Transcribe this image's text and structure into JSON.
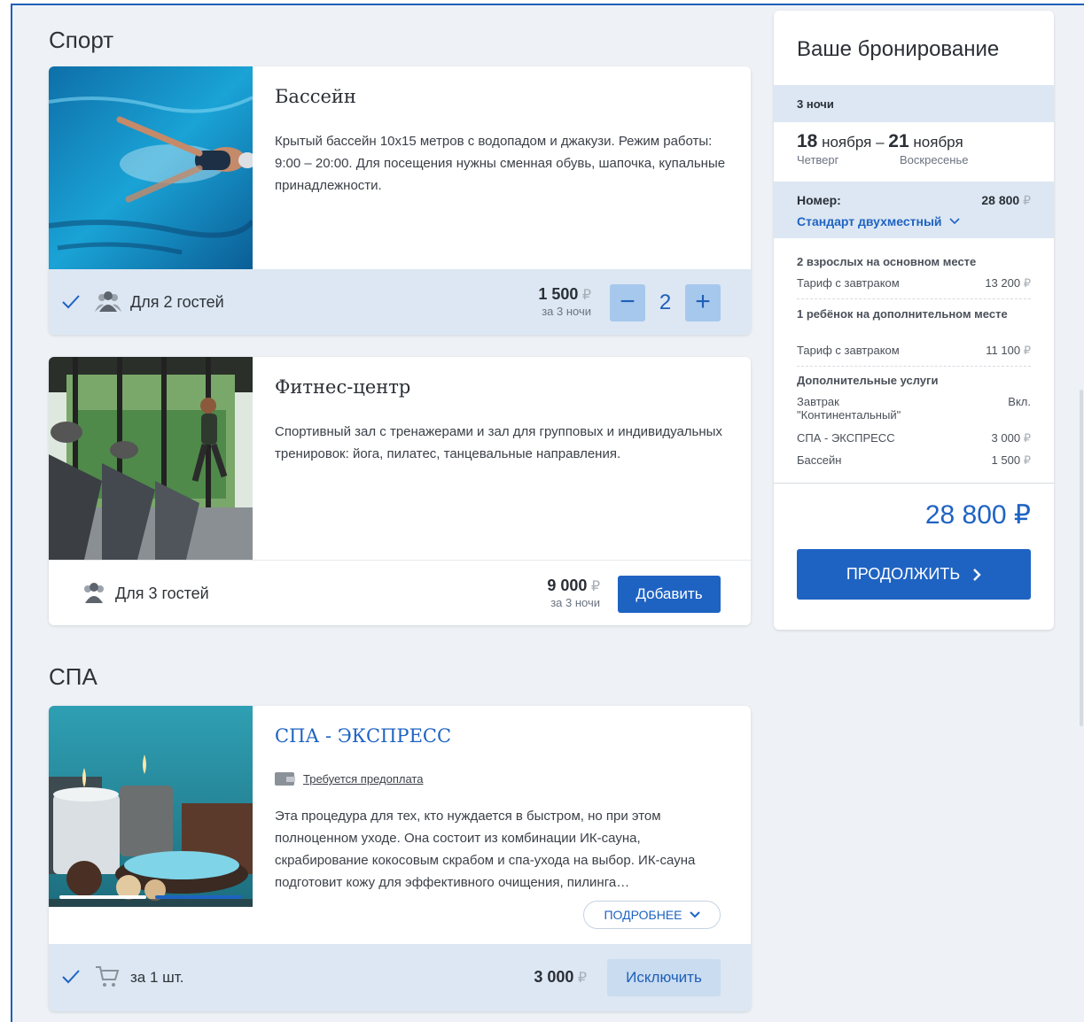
{
  "sections": {
    "sport": "Спорт",
    "spa": "СПА"
  },
  "currency": "₽",
  "cards": {
    "pool": {
      "title": "Бассейн",
      "description": "Крытый бассейн 10x15 метров с водопадом и джакузи. Режим работы: 9:00 – 20:00. Для посещения нужны сменная обувь, шапочка, купальные принадлежности.",
      "guests": "Для 2 гостей",
      "price": "1 500",
      "price_period": "за 3 ночи",
      "quantity": "2",
      "minus_label": "−",
      "plus_label": "+",
      "selected": true
    },
    "fitness": {
      "title": "Фитнес-центр",
      "description": "Спортивный зал с тренажерами и зал для групповых и индивидуальных тренировок: йога, пилатес, танцевальные направления.",
      "guests": "Для 3 гостей",
      "price": "9 000",
      "price_period": "за 3 ночи",
      "button": "Добавить"
    },
    "spa_express": {
      "title": "СПА - ЭКСПРЕСС",
      "prepayment": "Требуется предоплата",
      "description": "Эта процедура для тех, кто нуждается в быстром, но при этом полноценном уходе. Она состоит из комбинации ИК-сауна, скрабирование кокосовым скрабом и спа-ухода на выбор. ИК-сауна подготовит кожу для эффективного очищения, пилинга…",
      "more_button": "ПОДРОБНЕЕ",
      "unit": "за 1 шт.",
      "price": "3 000",
      "button": "Исключить",
      "selected": true
    }
  },
  "booking": {
    "title": "Ваше бронирование",
    "nights": "3 ночи",
    "date_from_day": "18",
    "date_from_month": "ноября",
    "date_dash": "–",
    "date_to_day": "21",
    "date_to_month": "ноября",
    "weekday_from": "Четверг",
    "weekday_to": "Воскресенье",
    "room_label": "Номер:",
    "room_price": "28 800",
    "room_type": "Стандарт двухместный",
    "adults_heading": "2 взрослых на основном месте",
    "adults_tariff": "Тариф с завтраком",
    "adults_price": "13 200",
    "child_heading": "1 ребёнок на дополнительном месте",
    "child_tariff": "Тариф с завтраком",
    "child_price": "11 100",
    "extras_heading": "Дополнительные услуги",
    "extras": [
      {
        "name": "Завтрак \"Континентальный\"",
        "value": "Вкл."
      },
      {
        "name": "СПА - ЭКСПРЕСС",
        "value": "3 000"
      },
      {
        "name": "Бассейн",
        "value": "1 500"
      }
    ],
    "total": "28 800 ₽",
    "continue_button": "ПРОДОЛЖИТЬ"
  },
  "colors": {
    "accent": "#1f63c2",
    "band": "#dce7f3",
    "background": "#eef2f6"
  }
}
